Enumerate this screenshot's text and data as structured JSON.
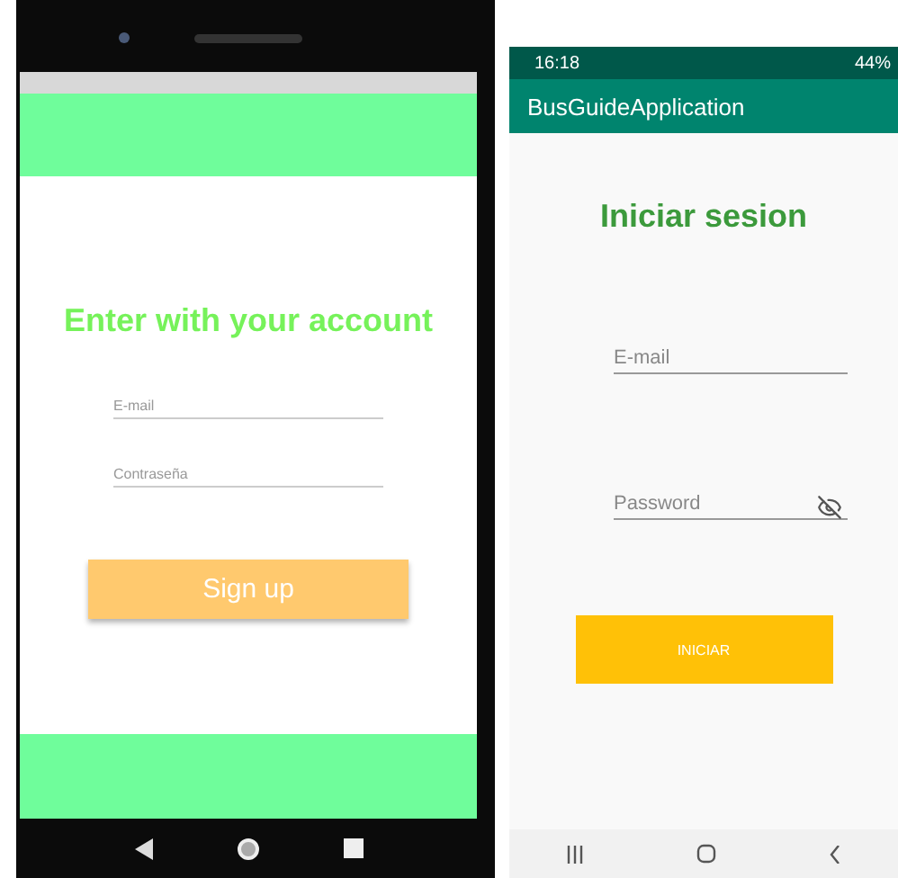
{
  "left_screen": {
    "title": "Enter with your account",
    "fields": [
      {
        "placeholder": "E-mail"
      },
      {
        "placeholder": "Contraseña"
      }
    ],
    "button": "Sign up"
  },
  "right_screen": {
    "status_bar": {
      "time": "16:18",
      "battery": "44%"
    },
    "app_bar": {
      "title": "BusGuideApplication"
    },
    "title": "Iniciar sesion",
    "fields": [
      {
        "placeholder": "E-mail",
        "kind": "text"
      },
      {
        "placeholder": "Password",
        "kind": "password"
      }
    ],
    "button": "INICIAR"
  }
}
